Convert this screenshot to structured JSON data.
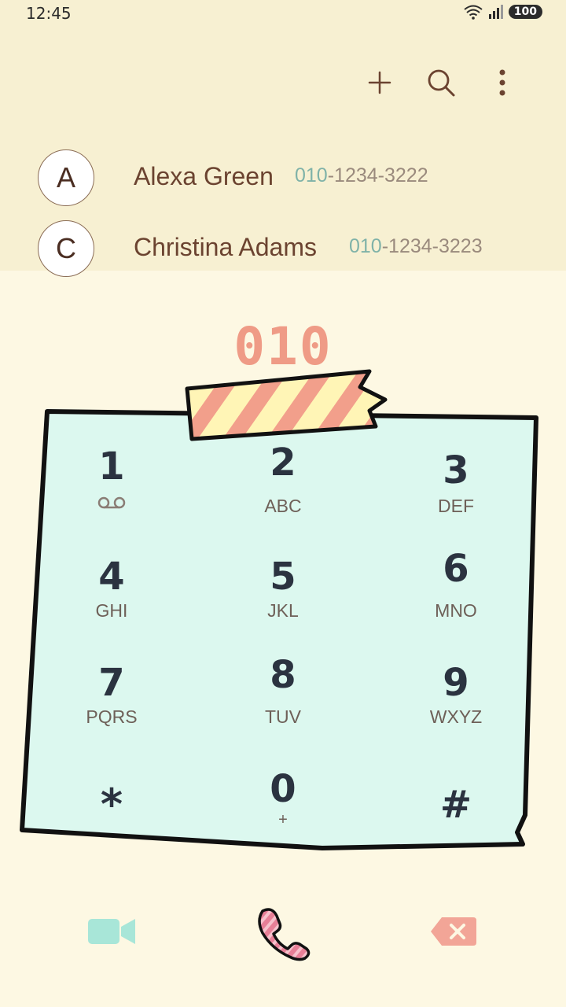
{
  "status_bar": {
    "time": "12:45",
    "battery": "100"
  },
  "toolbar": {
    "add_icon": "plus-icon",
    "search_icon": "search-icon",
    "more_icon": "more-vertical-icon"
  },
  "contacts": [
    {
      "initial": "A",
      "name": "Alexa Green",
      "number_match": "010",
      "number_rest": "-1234-3222"
    },
    {
      "initial": "C",
      "name": "Christina Adams",
      "number_match": "010",
      "number_rest": "-1234-3223"
    }
  ],
  "dialed": "010",
  "keypad": [
    {
      "num": "1",
      "letters": ""
    },
    {
      "num": "2",
      "letters": "ABC"
    },
    {
      "num": "3",
      "letters": "DEF"
    },
    {
      "num": "4",
      "letters": "GHI"
    },
    {
      "num": "5",
      "letters": "JKL"
    },
    {
      "num": "6",
      "letters": "MNO"
    },
    {
      "num": "7",
      "letters": "PQRS"
    },
    {
      "num": "8",
      "letters": "TUV"
    },
    {
      "num": "9",
      "letters": "WXYZ"
    },
    {
      "num": "*",
      "letters": ""
    },
    {
      "num": "0",
      "letters": "+"
    },
    {
      "num": "#",
      "letters": ""
    }
  ],
  "colors": {
    "top_bg": "#f7f0d2",
    "page_bg": "#fdf8e3",
    "pad_bg": "#dcf8ef",
    "accent": "#ef9b86",
    "match": "#7fb2a8",
    "video": "#a8e6d8",
    "delete": "#f2a597",
    "call": "#e77f97"
  }
}
